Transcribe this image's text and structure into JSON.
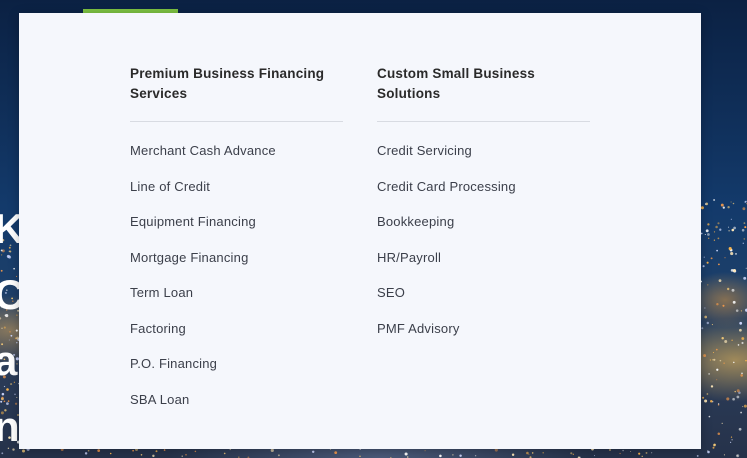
{
  "hero": {
    "partial_lines": [
      "K",
      "C",
      "ar",
      "nc"
    ]
  },
  "menu": {
    "columns": [
      {
        "heading": "Premium Business Financing Services",
        "items": [
          "Merchant Cash Advance",
          "Line of Credit",
          "Equipment Financing",
          "Mortgage Financing",
          "Term Loan",
          "Factoring",
          "P.O. Financing",
          "SBA Loan"
        ]
      },
      {
        "heading": "Custom Small Business Solutions",
        "items": [
          "Credit Servicing",
          "Credit Card Processing",
          "Bookkeeping",
          "HR/Payroll",
          "SEO",
          "PMF Advisory"
        ]
      }
    ]
  },
  "colors": {
    "accent": "#7cc142",
    "panel_background": "#f5f7fc",
    "heading_text": "#2a2a2a",
    "link_text": "#3b3f4a",
    "divider": "#d8dbe2",
    "page_background": "#0b2143"
  }
}
